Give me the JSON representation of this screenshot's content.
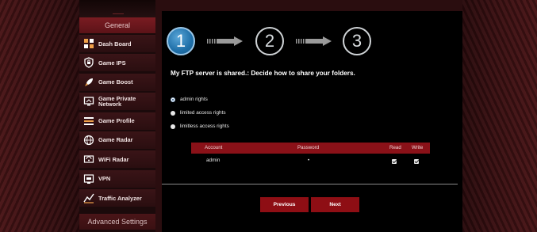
{
  "sidebar": {
    "section_label": "General",
    "items": [
      {
        "label": "Dash Board",
        "icon": "dashboard-icon"
      },
      {
        "label": "Game IPS",
        "icon": "shield-lock-icon"
      },
      {
        "label": "Game Boost",
        "icon": "rocket-icon"
      },
      {
        "label": "Game Private Network",
        "icon": "monitor-icon"
      },
      {
        "label": "Game Profile",
        "icon": "profile-list-icon"
      },
      {
        "label": "Game Radar",
        "icon": "globe-icon"
      },
      {
        "label": "WiFi Radar",
        "icon": "wifi-radar-icon"
      },
      {
        "label": "VPN",
        "icon": "vpn-icon"
      },
      {
        "label": "Traffic Analyzer",
        "icon": "chart-icon"
      }
    ],
    "advanced_label": "Advanced Settings"
  },
  "steps": [
    "1",
    "2",
    "3"
  ],
  "title": "My FTP server is shared.: Decide how to share your folders.",
  "options": [
    {
      "label": "admin rights",
      "checked": true
    },
    {
      "label": "limited access rights",
      "checked": false
    },
    {
      "label": "limitless access rights",
      "checked": false
    }
  ],
  "table": {
    "headers": {
      "account": "Account",
      "password": "Password",
      "read": "Read",
      "write": "Write"
    },
    "rows": [
      {
        "account": "admin",
        "password": "•",
        "read": true,
        "write": true
      }
    ]
  },
  "buttons": {
    "previous": "Previous",
    "next": "Next"
  },
  "colors": {
    "accent": "#8e0e14",
    "step_active": "#1f6fa8"
  }
}
